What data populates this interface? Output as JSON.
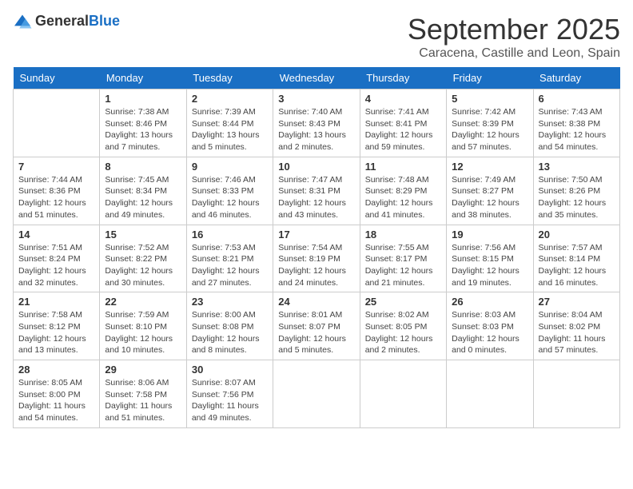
{
  "logo": {
    "general": "General",
    "blue": "Blue"
  },
  "title": "September 2025",
  "location": "Caracena, Castille and Leon, Spain",
  "days_of_week": [
    "Sunday",
    "Monday",
    "Tuesday",
    "Wednesday",
    "Thursday",
    "Friday",
    "Saturday"
  ],
  "weeks": [
    [
      {
        "day": "",
        "info": ""
      },
      {
        "day": "1",
        "info": "Sunrise: 7:38 AM\nSunset: 8:46 PM\nDaylight: 13 hours\nand 7 minutes."
      },
      {
        "day": "2",
        "info": "Sunrise: 7:39 AM\nSunset: 8:44 PM\nDaylight: 13 hours\nand 5 minutes."
      },
      {
        "day": "3",
        "info": "Sunrise: 7:40 AM\nSunset: 8:43 PM\nDaylight: 13 hours\nand 2 minutes."
      },
      {
        "day": "4",
        "info": "Sunrise: 7:41 AM\nSunset: 8:41 PM\nDaylight: 12 hours\nand 59 minutes."
      },
      {
        "day": "5",
        "info": "Sunrise: 7:42 AM\nSunset: 8:39 PM\nDaylight: 12 hours\nand 57 minutes."
      },
      {
        "day": "6",
        "info": "Sunrise: 7:43 AM\nSunset: 8:38 PM\nDaylight: 12 hours\nand 54 minutes."
      }
    ],
    [
      {
        "day": "7",
        "info": "Sunrise: 7:44 AM\nSunset: 8:36 PM\nDaylight: 12 hours\nand 51 minutes."
      },
      {
        "day": "8",
        "info": "Sunrise: 7:45 AM\nSunset: 8:34 PM\nDaylight: 12 hours\nand 49 minutes."
      },
      {
        "day": "9",
        "info": "Sunrise: 7:46 AM\nSunset: 8:33 PM\nDaylight: 12 hours\nand 46 minutes."
      },
      {
        "day": "10",
        "info": "Sunrise: 7:47 AM\nSunset: 8:31 PM\nDaylight: 12 hours\nand 43 minutes."
      },
      {
        "day": "11",
        "info": "Sunrise: 7:48 AM\nSunset: 8:29 PM\nDaylight: 12 hours\nand 41 minutes."
      },
      {
        "day": "12",
        "info": "Sunrise: 7:49 AM\nSunset: 8:27 PM\nDaylight: 12 hours\nand 38 minutes."
      },
      {
        "day": "13",
        "info": "Sunrise: 7:50 AM\nSunset: 8:26 PM\nDaylight: 12 hours\nand 35 minutes."
      }
    ],
    [
      {
        "day": "14",
        "info": "Sunrise: 7:51 AM\nSunset: 8:24 PM\nDaylight: 12 hours\nand 32 minutes."
      },
      {
        "day": "15",
        "info": "Sunrise: 7:52 AM\nSunset: 8:22 PM\nDaylight: 12 hours\nand 30 minutes."
      },
      {
        "day": "16",
        "info": "Sunrise: 7:53 AM\nSunset: 8:21 PM\nDaylight: 12 hours\nand 27 minutes."
      },
      {
        "day": "17",
        "info": "Sunrise: 7:54 AM\nSunset: 8:19 PM\nDaylight: 12 hours\nand 24 minutes."
      },
      {
        "day": "18",
        "info": "Sunrise: 7:55 AM\nSunset: 8:17 PM\nDaylight: 12 hours\nand 21 minutes."
      },
      {
        "day": "19",
        "info": "Sunrise: 7:56 AM\nSunset: 8:15 PM\nDaylight: 12 hours\nand 19 minutes."
      },
      {
        "day": "20",
        "info": "Sunrise: 7:57 AM\nSunset: 8:14 PM\nDaylight: 12 hours\nand 16 minutes."
      }
    ],
    [
      {
        "day": "21",
        "info": "Sunrise: 7:58 AM\nSunset: 8:12 PM\nDaylight: 12 hours\nand 13 minutes."
      },
      {
        "day": "22",
        "info": "Sunrise: 7:59 AM\nSunset: 8:10 PM\nDaylight: 12 hours\nand 10 minutes."
      },
      {
        "day": "23",
        "info": "Sunrise: 8:00 AM\nSunset: 8:08 PM\nDaylight: 12 hours\nand 8 minutes."
      },
      {
        "day": "24",
        "info": "Sunrise: 8:01 AM\nSunset: 8:07 PM\nDaylight: 12 hours\nand 5 minutes."
      },
      {
        "day": "25",
        "info": "Sunrise: 8:02 AM\nSunset: 8:05 PM\nDaylight: 12 hours\nand 2 minutes."
      },
      {
        "day": "26",
        "info": "Sunrise: 8:03 AM\nSunset: 8:03 PM\nDaylight: 12 hours\nand 0 minutes."
      },
      {
        "day": "27",
        "info": "Sunrise: 8:04 AM\nSunset: 8:02 PM\nDaylight: 11 hours\nand 57 minutes."
      }
    ],
    [
      {
        "day": "28",
        "info": "Sunrise: 8:05 AM\nSunset: 8:00 PM\nDaylight: 11 hours\nand 54 minutes."
      },
      {
        "day": "29",
        "info": "Sunrise: 8:06 AM\nSunset: 7:58 PM\nDaylight: 11 hours\nand 51 minutes."
      },
      {
        "day": "30",
        "info": "Sunrise: 8:07 AM\nSunset: 7:56 PM\nDaylight: 11 hours\nand 49 minutes."
      },
      {
        "day": "",
        "info": ""
      },
      {
        "day": "",
        "info": ""
      },
      {
        "day": "",
        "info": ""
      },
      {
        "day": "",
        "info": ""
      }
    ]
  ]
}
